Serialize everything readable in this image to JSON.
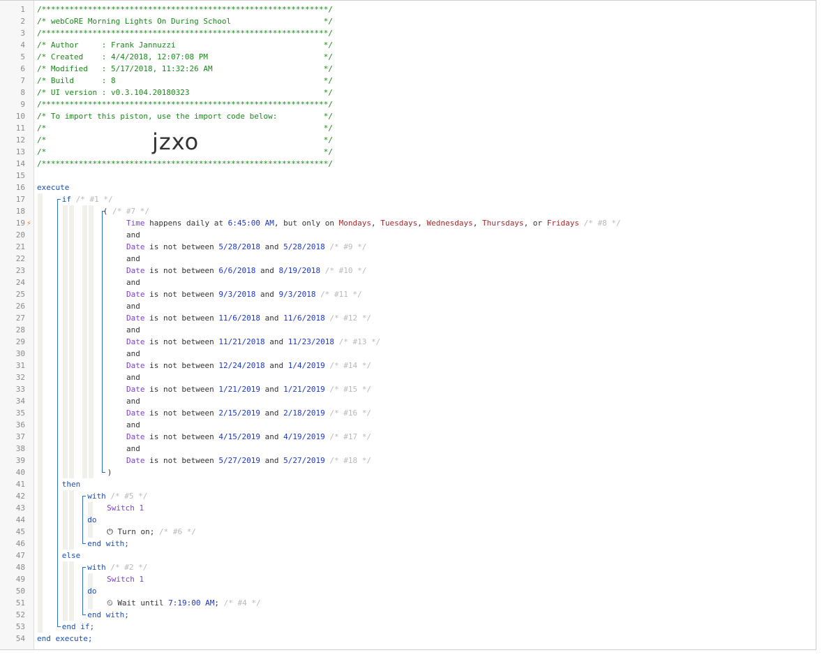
{
  "header": [
    "/**************************************************************/",
    "/* webCoRE Morning Lights On During School                    */",
    "/**************************************************************/",
    "/* Author     : Frank Jannuzzi                                */",
    "/* Created    : 4/4/2018, 12:07:08 PM                         */",
    "/* Modified   : 5/17/2018, 11:32:26 AM                        */",
    "/* Build      : 8                                             */",
    "/* UI version : v0.3.104.20180323                             */",
    "/**************************************************************/",
    "/* To import this piston, use the import code below:          */",
    "/*                                                            */",
    "/*                                                            */",
    "/*                                                            */",
    "/**************************************************************/"
  ],
  "import_code": "jzxo",
  "piston": {
    "execute": "execute",
    "if": "if",
    "if_comment": "/* #1 */",
    "group_open": "(",
    "group_comment": "/* #7 */",
    "time_condition": {
      "subject": "Time",
      "text1": " happens daily at ",
      "time": "6:45:00 AM",
      "text2": ", but only on ",
      "days": [
        "Mondays",
        "Tuesdays",
        "Wednesdays",
        "Thursdays",
        "Fridays"
      ],
      "sep": ", ",
      "or": ", or ",
      "comment": "/* #8 */"
    },
    "and": "and",
    "date_subject": "Date",
    "date_text": " is not between ",
    "date_and": " and ",
    "date_conditions": [
      {
        "from": "5/28/2018",
        "to": "5/28/2018",
        "comment": "/* #9 */"
      },
      {
        "from": "6/6/2018",
        "to": "8/19/2018",
        "comment": "/* #10 */"
      },
      {
        "from": "9/3/2018",
        "to": "9/3/2018",
        "comment": "/* #11 */"
      },
      {
        "from": "11/6/2018",
        "to": "11/6/2018",
        "comment": "/* #12 */"
      },
      {
        "from": "11/21/2018",
        "to": "11/23/2018",
        "comment": "/* #13 */"
      },
      {
        "from": "12/24/2018",
        "to": "1/4/2019",
        "comment": "/* #14 */"
      },
      {
        "from": "1/21/2019",
        "to": "1/21/2019",
        "comment": "/* #15 */"
      },
      {
        "from": "2/15/2019",
        "to": "2/18/2019",
        "comment": "/* #16 */"
      },
      {
        "from": "4/15/2019",
        "to": "4/19/2019",
        "comment": "/* #17 */"
      },
      {
        "from": "5/27/2019",
        "to": "5/27/2019",
        "comment": "/* #18 */"
      }
    ],
    "group_close": ")",
    "then": "then",
    "with": "with",
    "with1_comment": "/* #5 */",
    "device": "Switch 1",
    "do": "do",
    "turn_on": "Turn on;",
    "turn_on_comment": "/* #6 */",
    "end_with": "end with;",
    "else": "else",
    "with2_comment": "/* #2 */",
    "wait_text": "Wait until ",
    "wait_time": "7:19:00 AM",
    "wait_semi": ";",
    "wait_comment": "/* #4 */",
    "end_if": "end if;",
    "end_execute": "end execute;"
  },
  "icons": {
    "trigger": "lightning-bolt-icon",
    "turn_on": "power-icon",
    "wait": "clock-icon"
  },
  "colors": {
    "comment_green": "#1a8a1a",
    "keyword_blue": "#1a4fb5",
    "device_purple": "#7a3fd6",
    "value_blue": "#1a35d4",
    "literal_red": "#b02626",
    "dim_comment": "#b9b9b9",
    "trigger_orange": "#f07b2a"
  }
}
